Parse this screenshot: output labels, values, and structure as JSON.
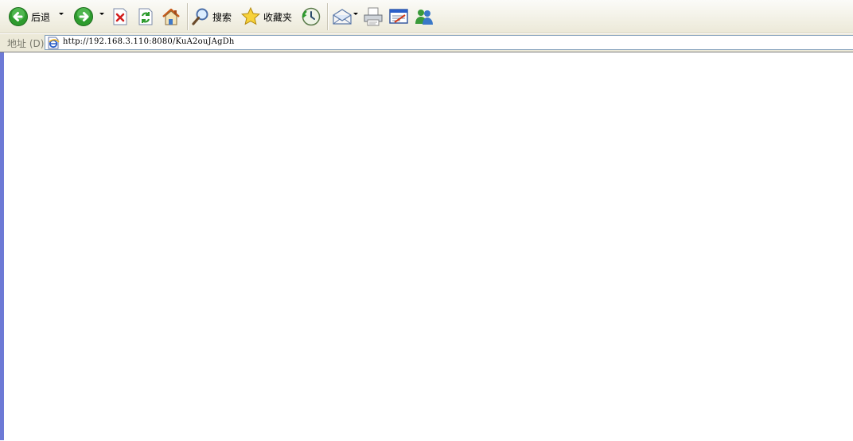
{
  "toolbar": {
    "back_label": "后退",
    "search_label": "搜索",
    "favorites_label": "收藏夹"
  },
  "address": {
    "label": "地址 (D)",
    "url": "http://192.168.3.110:8080/KuA2ouJAgDh"
  },
  "icons": {
    "back": "back-arrow-icon",
    "forward": "forward-arrow-icon",
    "stop": "stop-icon",
    "refresh": "refresh-icon",
    "home": "home-icon",
    "search": "magnifier-icon",
    "favorites": "star-icon",
    "history": "history-icon",
    "mail": "mail-icon",
    "print": "printer-icon",
    "edit": "edit-icon",
    "messenger": "messenger-icon",
    "page": "ie-page-icon"
  },
  "colors": {
    "toolbar_bg": "#ece9d8",
    "nav_green": "#2e9b2e",
    "stop_red": "#d21f1f",
    "content_bg": "#ffffff",
    "edge_blue": "#6d7ad6"
  }
}
